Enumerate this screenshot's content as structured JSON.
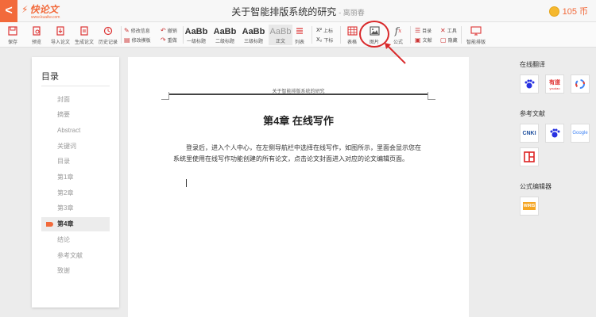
{
  "header": {
    "back_glyph": "<",
    "logo_text": "快论文",
    "logo_url": "www.kuailw.com",
    "doc_title": "关于智能排版系统的研究",
    "author": "- 离丽春",
    "coins": "105 币"
  },
  "toolbar": {
    "save": "保存",
    "preview": "预览",
    "import": "导入论文",
    "generate": "生成论文",
    "history": "历史记录",
    "edit_info": "修改信息",
    "edit_template": "修改模板",
    "undo": "撤销",
    "redo": "重做",
    "style_sample": "AaBb",
    "h1": "一级标题",
    "h2": "二级标题",
    "h3": "三级标题",
    "body_style": "正文",
    "list": "列表",
    "superscript": "上标",
    "subscript": "下标",
    "table": "表格",
    "image": "图片",
    "formula": "公式",
    "toc": "目录",
    "tools": "工具",
    "references": "文献",
    "hide": "隐藏",
    "smart_layout": "智能排版"
  },
  "toc": {
    "title": "目录",
    "items": [
      "封面",
      "摘要",
      "Abstract",
      "关键词",
      "目录",
      "第1章",
      "第2章",
      "第3章",
      "第4章",
      "结论",
      "参考文献",
      "致谢"
    ],
    "active_index": 8
  },
  "document": {
    "running_header": "关于智能排版系统的研究",
    "chapter_title": "第4章 在线写作",
    "paragraph": "登录后，进入个人中心，在左侧导航栏中选择在线写作，如图所示，里面会显示您在系统里使用在线写作功能创建的所有论文，点击论文封面进入对应的论文编辑页面。"
  },
  "right_panel": {
    "translate_title": "在线翻译",
    "references_title": "参考文献",
    "formula_title": "公式编辑器",
    "youdao_label": "有道",
    "youdao_sub": "youdao",
    "google_label": "Google",
    "cnki_label": "CNKI",
    "wiris_label": "WIRIS"
  },
  "colors": {
    "brand": "#f26a3b",
    "annotation": "#d9282a"
  }
}
